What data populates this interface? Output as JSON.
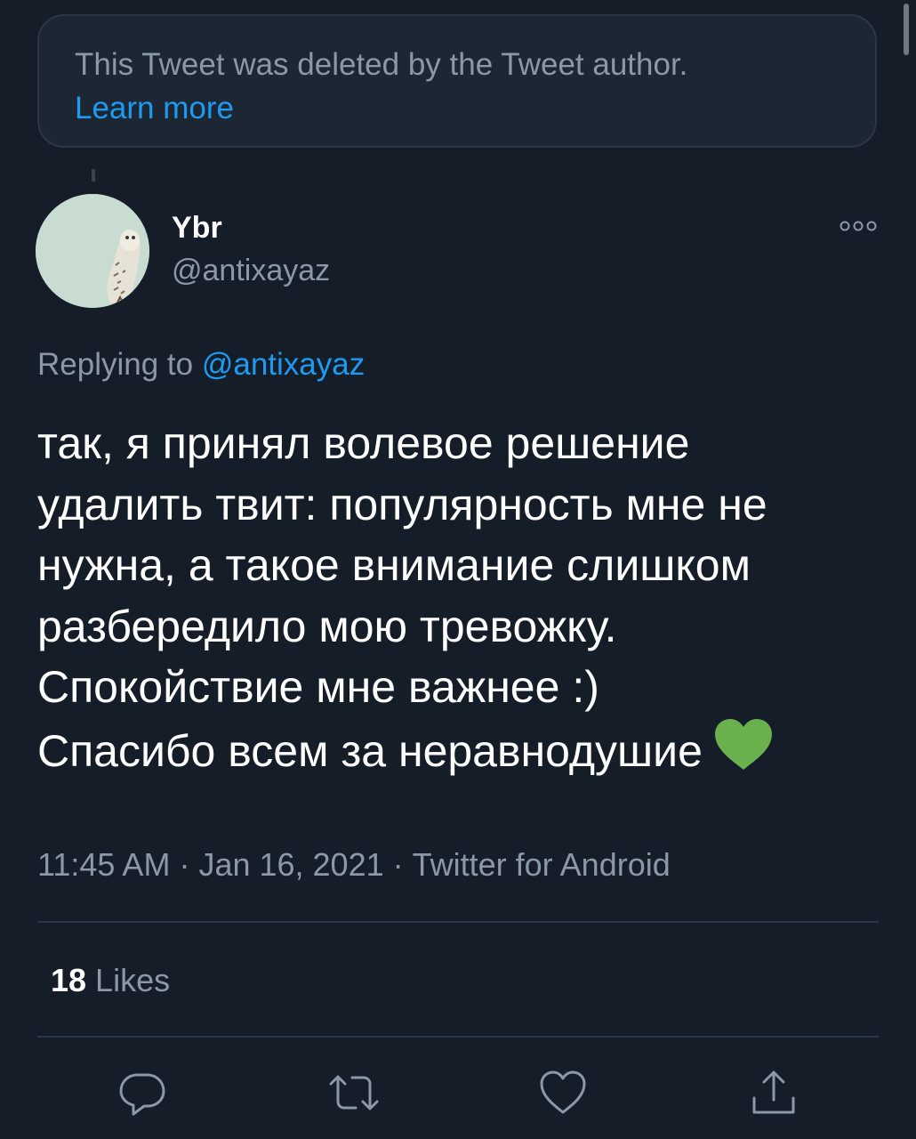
{
  "deleted_notice": {
    "text": "This Tweet was deleted by the Tweet author.",
    "link": "Learn more"
  },
  "author": {
    "display_name": "Ybr",
    "handle": "@antixayaz"
  },
  "reply": {
    "prefix": "Replying to",
    "mention": "@antixayaz"
  },
  "tweet": {
    "lines": [
      "так, я принял волевое решение",
      "удалить твит: популярность мне не",
      "нужна, а такое внимание слишком",
      "разбередило мою тревожку.",
      "Спокойствие мне важнее :)",
      "Спасибо всем за неравнодушие"
    ],
    "emoji": "green-heart"
  },
  "meta": {
    "time": "11:45 AM",
    "separator": "·",
    "date": "Jan 16, 2021",
    "source": "Twitter for Android"
  },
  "stats": {
    "likes_count": "18",
    "likes_label": "Likes"
  },
  "actions": [
    "reply-icon",
    "retweet-icon",
    "like-icon",
    "share-icon"
  ],
  "colors": {
    "background": "#151d29",
    "accent": "#1d9bf0",
    "secondary_text": "#8b98a5",
    "heart": "#6ab04c"
  }
}
